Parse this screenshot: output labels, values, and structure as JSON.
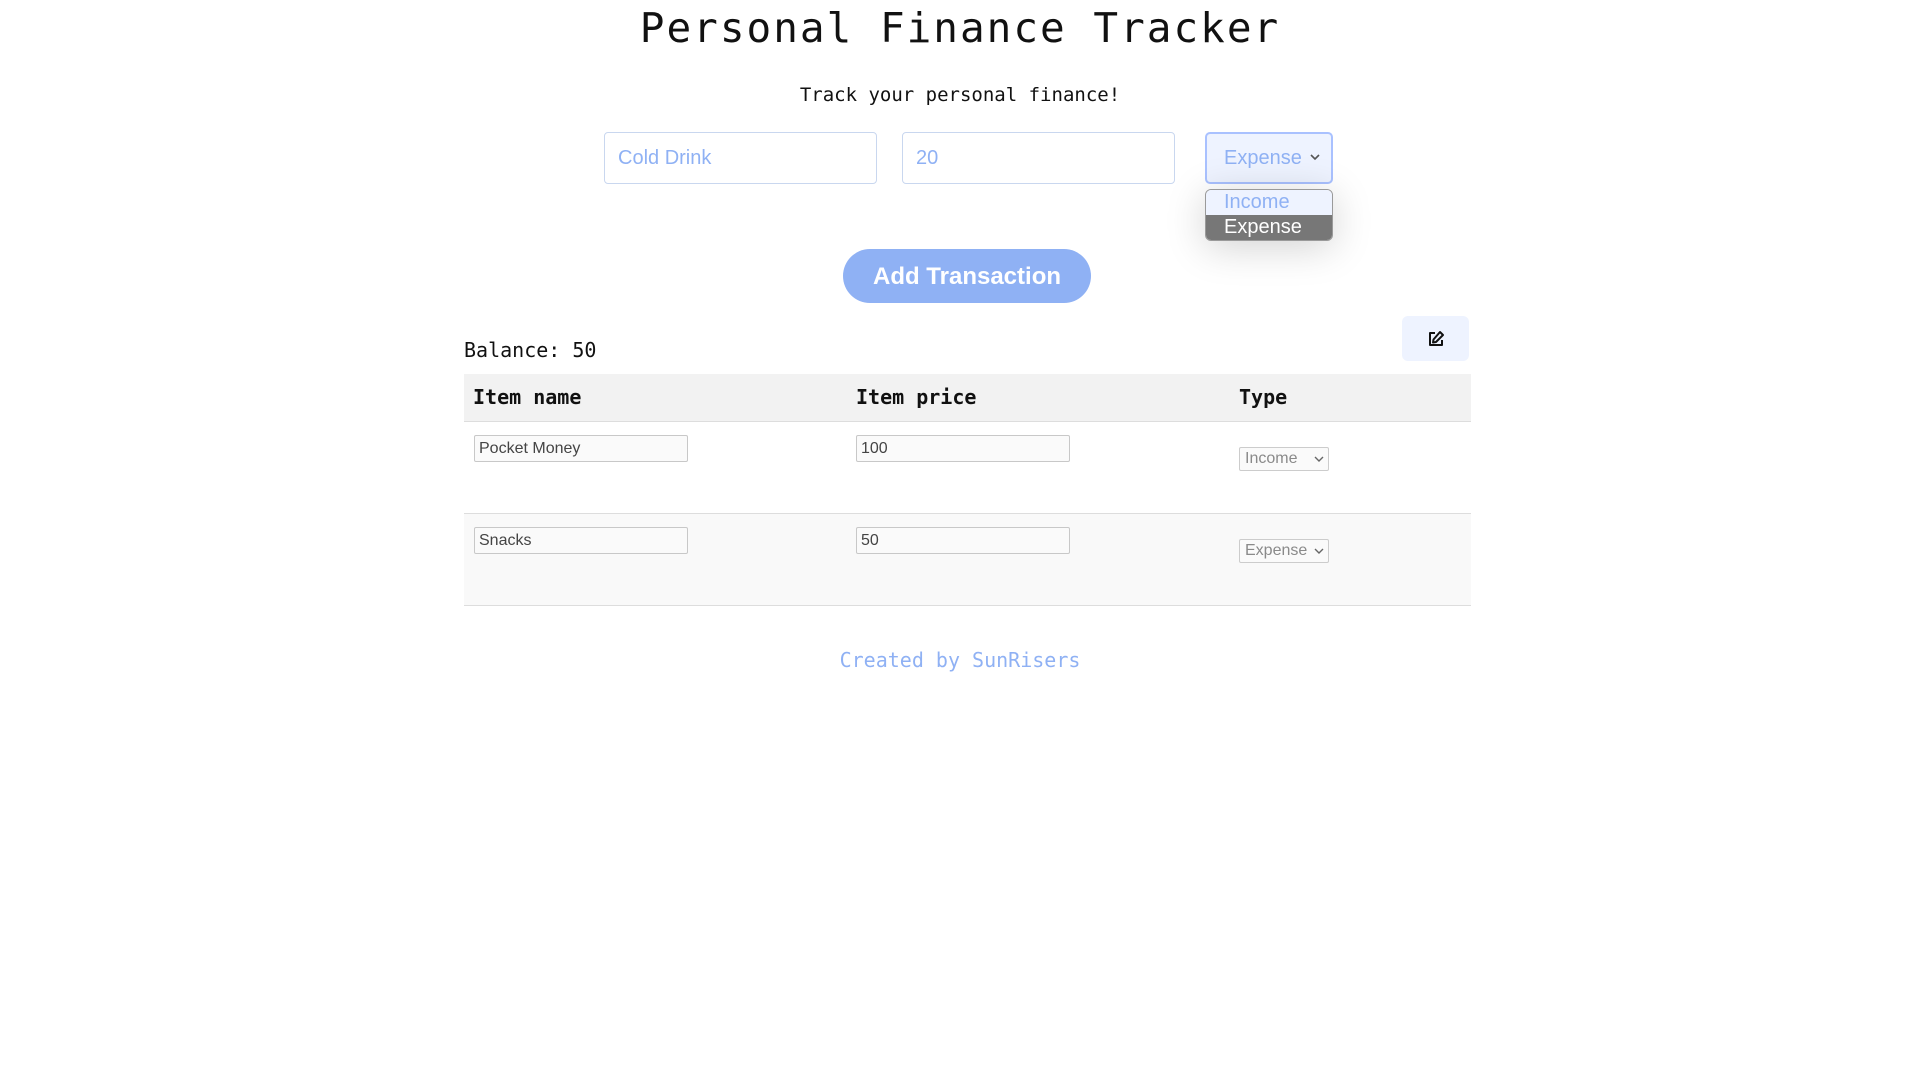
{
  "header": {
    "title": "Personal Finance Tracker",
    "subtitle": "Track your personal finance!"
  },
  "form": {
    "name_input": {
      "value": "",
      "placeholder": "Cold Drink"
    },
    "price_input": {
      "value": "",
      "placeholder": "20"
    },
    "type_select": {
      "selected": "Expense",
      "options": [
        "Income",
        "Expense"
      ],
      "highlighted_option": "Expense",
      "open": true
    },
    "add_button_label": "Add Transaction"
  },
  "balance": {
    "text": "Balance: 50"
  },
  "edit_button": {
    "icon": "edit-icon"
  },
  "table": {
    "headers": [
      "Item name",
      "Item price",
      "Type"
    ],
    "rows": [
      {
        "name": "Pocket Money",
        "price": "100",
        "type": "Income"
      },
      {
        "name": "Snacks",
        "price": "50",
        "type": "Expense"
      }
    ]
  },
  "footer": {
    "text": "Created by SunRisers"
  },
  "colors": {
    "accent": "#8fb1f4",
    "accent_light": "#eef3ff",
    "highlight_option": "#777777"
  }
}
